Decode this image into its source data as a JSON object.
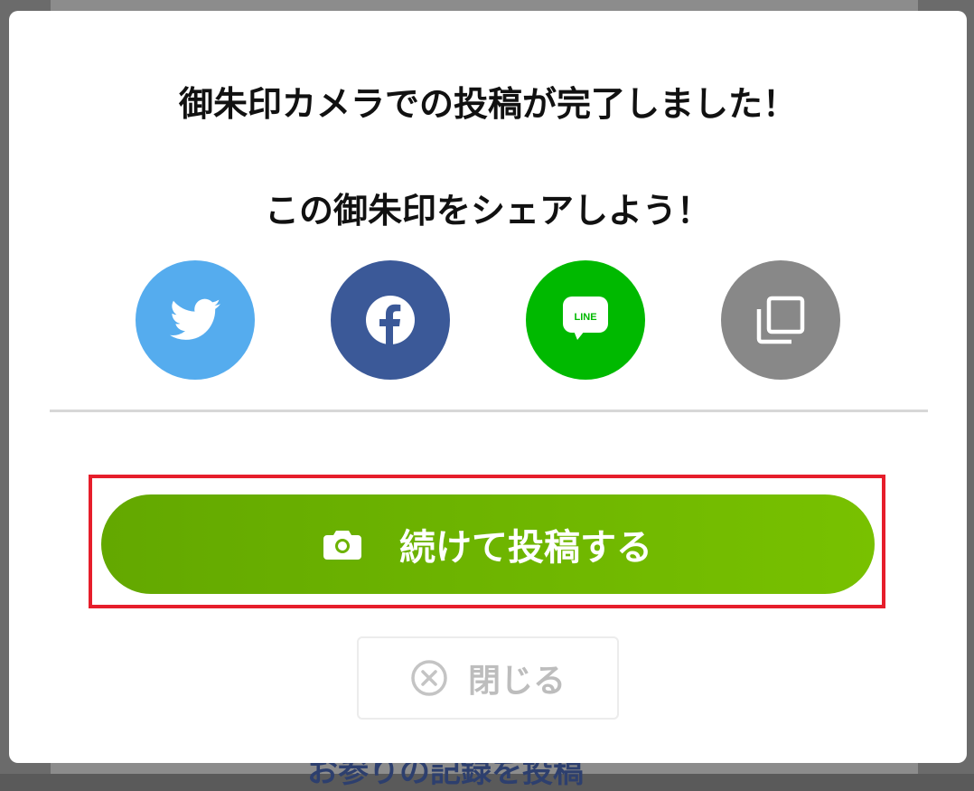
{
  "background": {
    "link_text": "お参りの記録を投稿"
  },
  "modal": {
    "title": "御朱印カメラでの投稿が完了しました！",
    "subtitle": "この御朱印をシェアしよう！",
    "share_buttons": [
      {
        "name": "twitter",
        "icon": "twitter-bird-icon",
        "color": "#55acee"
      },
      {
        "name": "facebook",
        "icon": "facebook-icon",
        "color": "#3b5998"
      },
      {
        "name": "line",
        "icon": "line-icon",
        "color": "#00b900",
        "icon_text": "LINE"
      },
      {
        "name": "copy",
        "icon": "copy-icon",
        "color": "#888888"
      }
    ],
    "continue_button": {
      "label": "続けて投稿する",
      "icon": "camera-icon",
      "color": "#6cb200"
    },
    "close_button": {
      "label": "閉じる",
      "icon": "close-circle-icon"
    },
    "highlight_color": "#e61e2b"
  }
}
